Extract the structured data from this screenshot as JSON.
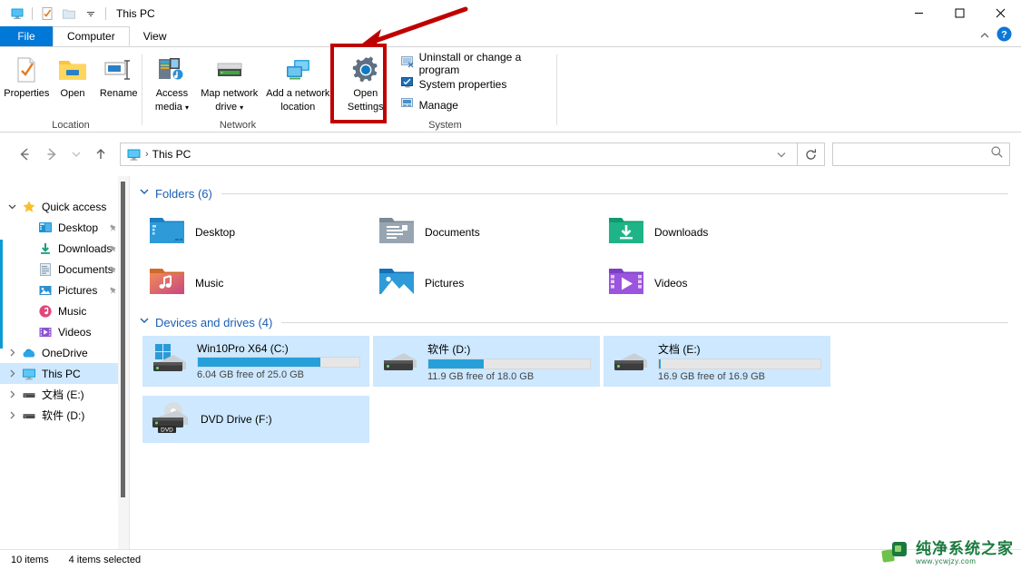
{
  "window": {
    "title": "This PC",
    "quick_access_icons": [
      "monitor-icon",
      "properties-icon",
      "folder-icon",
      "dropdown-icon"
    ],
    "controls": {
      "minimize": "—",
      "maximize": "☐",
      "close": "✕"
    },
    "ribbon_collapse": "^",
    "help": "?"
  },
  "tabs": [
    {
      "label": "File",
      "id": "file"
    },
    {
      "label": "Computer",
      "id": "computer"
    },
    {
      "label": "View",
      "id": "view"
    }
  ],
  "ribbon": {
    "groups": [
      {
        "label": "Location",
        "buttons": [
          {
            "label": "Properties",
            "icon": "properties-icon"
          },
          {
            "label": "Open",
            "icon": "open-folder-icon"
          },
          {
            "label": "Rename",
            "icon": "rename-icon"
          }
        ]
      },
      {
        "label": "Network",
        "buttons": [
          {
            "label": "Access\nmedia",
            "line1": "Access",
            "line2": "media",
            "icon": "access-media-icon",
            "has_arrow": true
          },
          {
            "label": "Map network\ndrive",
            "line1": "Map network",
            "line2": "drive",
            "icon": "map-drive-icon",
            "has_arrow": true
          },
          {
            "label": "Add a network\nlocation",
            "line1": "Add a network",
            "line2": "location",
            "icon": "add-network-location-icon",
            "has_arrow": false
          }
        ]
      },
      {
        "label": "System",
        "highlighted_button": {
          "line1": "Open",
          "line2": "Settings",
          "icon": "settings-gear-icon"
        },
        "small_items": [
          {
            "label": "Uninstall or change a program",
            "icon": "uninstall-icon"
          },
          {
            "label": "System properties",
            "icon": "system-properties-icon"
          },
          {
            "label": "Manage",
            "icon": "manage-icon"
          }
        ]
      }
    ]
  },
  "address": {
    "back": "←",
    "forward": "→",
    "recent": "⌄",
    "up": "↑",
    "breadcrumb_icon": "monitor-icon",
    "breadcrumb_text": "This PC",
    "separator": "›",
    "dropdown": "⌄",
    "refresh": "⟳",
    "search_placeholder": "",
    "search_value": "",
    "search_icon": "search-icon"
  },
  "sidebar": {
    "items": [
      {
        "label": "Quick access",
        "icon": "star-icon",
        "chevron": "expanded",
        "indent": 0,
        "pinned": false,
        "selected": false
      },
      {
        "label": "Desktop",
        "icon": "desktop-icon",
        "chevron": "none",
        "indent": 1,
        "pinned": true,
        "selected": false
      },
      {
        "label": "Downloads",
        "icon": "downloads-icon",
        "chevron": "none",
        "indent": 1,
        "pinned": true,
        "selected": false
      },
      {
        "label": "Documents",
        "icon": "documents-icon",
        "chevron": "none",
        "indent": 1,
        "pinned": true,
        "selected": false
      },
      {
        "label": "Pictures",
        "icon": "pictures-icon",
        "chevron": "none",
        "indent": 1,
        "pinned": true,
        "selected": false
      },
      {
        "label": "Music",
        "icon": "music-icon",
        "chevron": "none",
        "indent": 1,
        "pinned": false,
        "selected": false
      },
      {
        "label": "Videos",
        "icon": "videos-icon",
        "chevron": "none",
        "indent": 1,
        "pinned": false,
        "selected": false
      },
      {
        "label": "OneDrive",
        "icon": "onedrive-icon",
        "chevron": "collapsed",
        "indent": 0,
        "pinned": false,
        "selected": false
      },
      {
        "label": "This PC",
        "icon": "monitor-icon",
        "chevron": "collapsed",
        "indent": 0,
        "pinned": false,
        "selected": true
      },
      {
        "label": "文档 (E:)",
        "icon": "drive-icon",
        "chevron": "collapsed",
        "indent": 0,
        "pinned": false,
        "selected": false
      },
      {
        "label": "软件 (D:)",
        "icon": "drive-icon",
        "chevron": "collapsed",
        "indent": 0,
        "pinned": false,
        "selected": false
      }
    ]
  },
  "content": {
    "folders_group": {
      "title": "Folders (6)",
      "collapsed": false
    },
    "folders": [
      {
        "label": "Desktop",
        "icon": "desktop-folder-icon"
      },
      {
        "label": "Documents",
        "icon": "documents-folder-icon"
      },
      {
        "label": "Downloads",
        "icon": "downloads-folder-icon"
      },
      {
        "label": "Music",
        "icon": "music-folder-icon"
      },
      {
        "label": "Pictures",
        "icon": "pictures-folder-icon"
      },
      {
        "label": "Videos",
        "icon": "videos-folder-icon"
      }
    ],
    "drives_group": {
      "title": "Devices and drives (4)",
      "collapsed": false
    },
    "drives": [
      {
        "name": "Win10Pro X64 (C:)",
        "free_text": "6.04 GB free of 25.0 GB",
        "used_percent": 76,
        "icon": "windows-drive-icon",
        "selected": true,
        "bar_color": "#26a0da"
      },
      {
        "name": "软件 (D:)",
        "free_text": "11.9 GB free of 18.0 GB",
        "used_percent": 34,
        "icon": "hard-drive-icon",
        "selected": true,
        "bar_color": "#26a0da"
      },
      {
        "name": "文档 (E:)",
        "free_text": "16.9 GB free of 16.9 GB",
        "used_percent": 1,
        "icon": "hard-drive-icon",
        "selected": true,
        "bar_color": "#26a0da"
      }
    ],
    "dvd": {
      "name": "DVD Drive (F:)",
      "icon": "dvd-drive-icon",
      "badge": "DVD",
      "selected": true
    }
  },
  "status": {
    "item_count": "10 items",
    "selection": "4 items selected"
  },
  "watermark": {
    "main": "纯净系统之家",
    "sub": "www.ycwjzy.com"
  },
  "annotation": {
    "box_color": "#c00000",
    "arrow_color": "#c00000",
    "target": "Open Settings"
  }
}
